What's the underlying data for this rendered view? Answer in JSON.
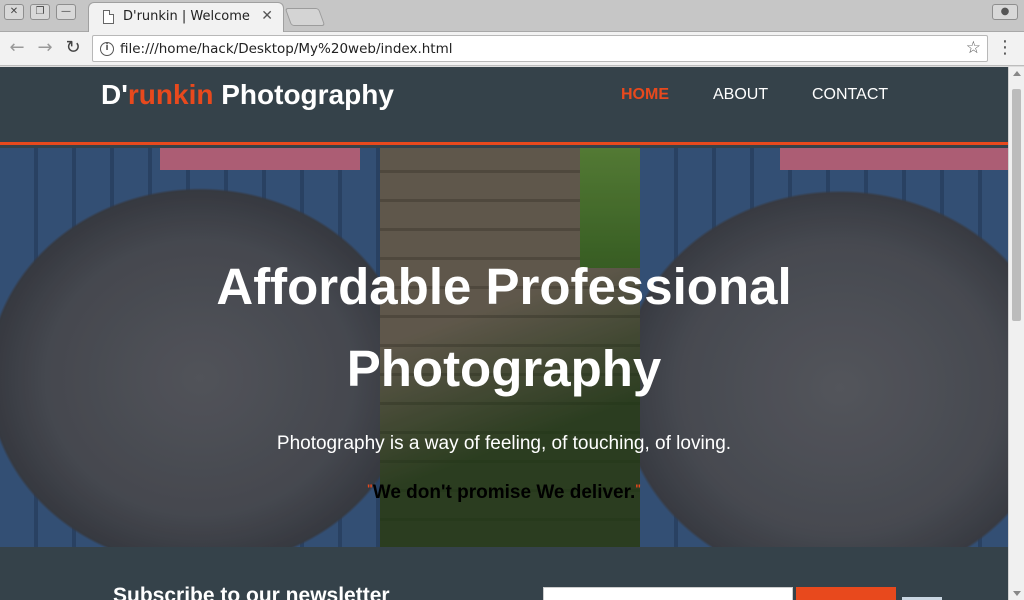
{
  "browser": {
    "tab_title": "D'runkin | Welcome",
    "url": "file:///home/hack/Desktop/My%20web/index.html",
    "window_buttons": [
      "close",
      "restore",
      "minimize"
    ]
  },
  "site": {
    "logo": {
      "part1": "D'",
      "highlight": "runkin",
      "part2": " Photography"
    },
    "nav": [
      {
        "label": "HOME",
        "current": true
      },
      {
        "label": "ABOUT",
        "current": false
      },
      {
        "label": "CONTACT",
        "current": false
      }
    ],
    "hero": {
      "title_line1": "Affordable Professional",
      "title_line2": "Photography",
      "subtitle": "Photography is a way of feeling, of touching, of loving.",
      "tagline": "We don't promise We deliver."
    },
    "newsletter": {
      "title": "Subscribe to our newsletter"
    }
  },
  "colors": {
    "accent": "#e8491d",
    "header_bg": "#35424a"
  }
}
